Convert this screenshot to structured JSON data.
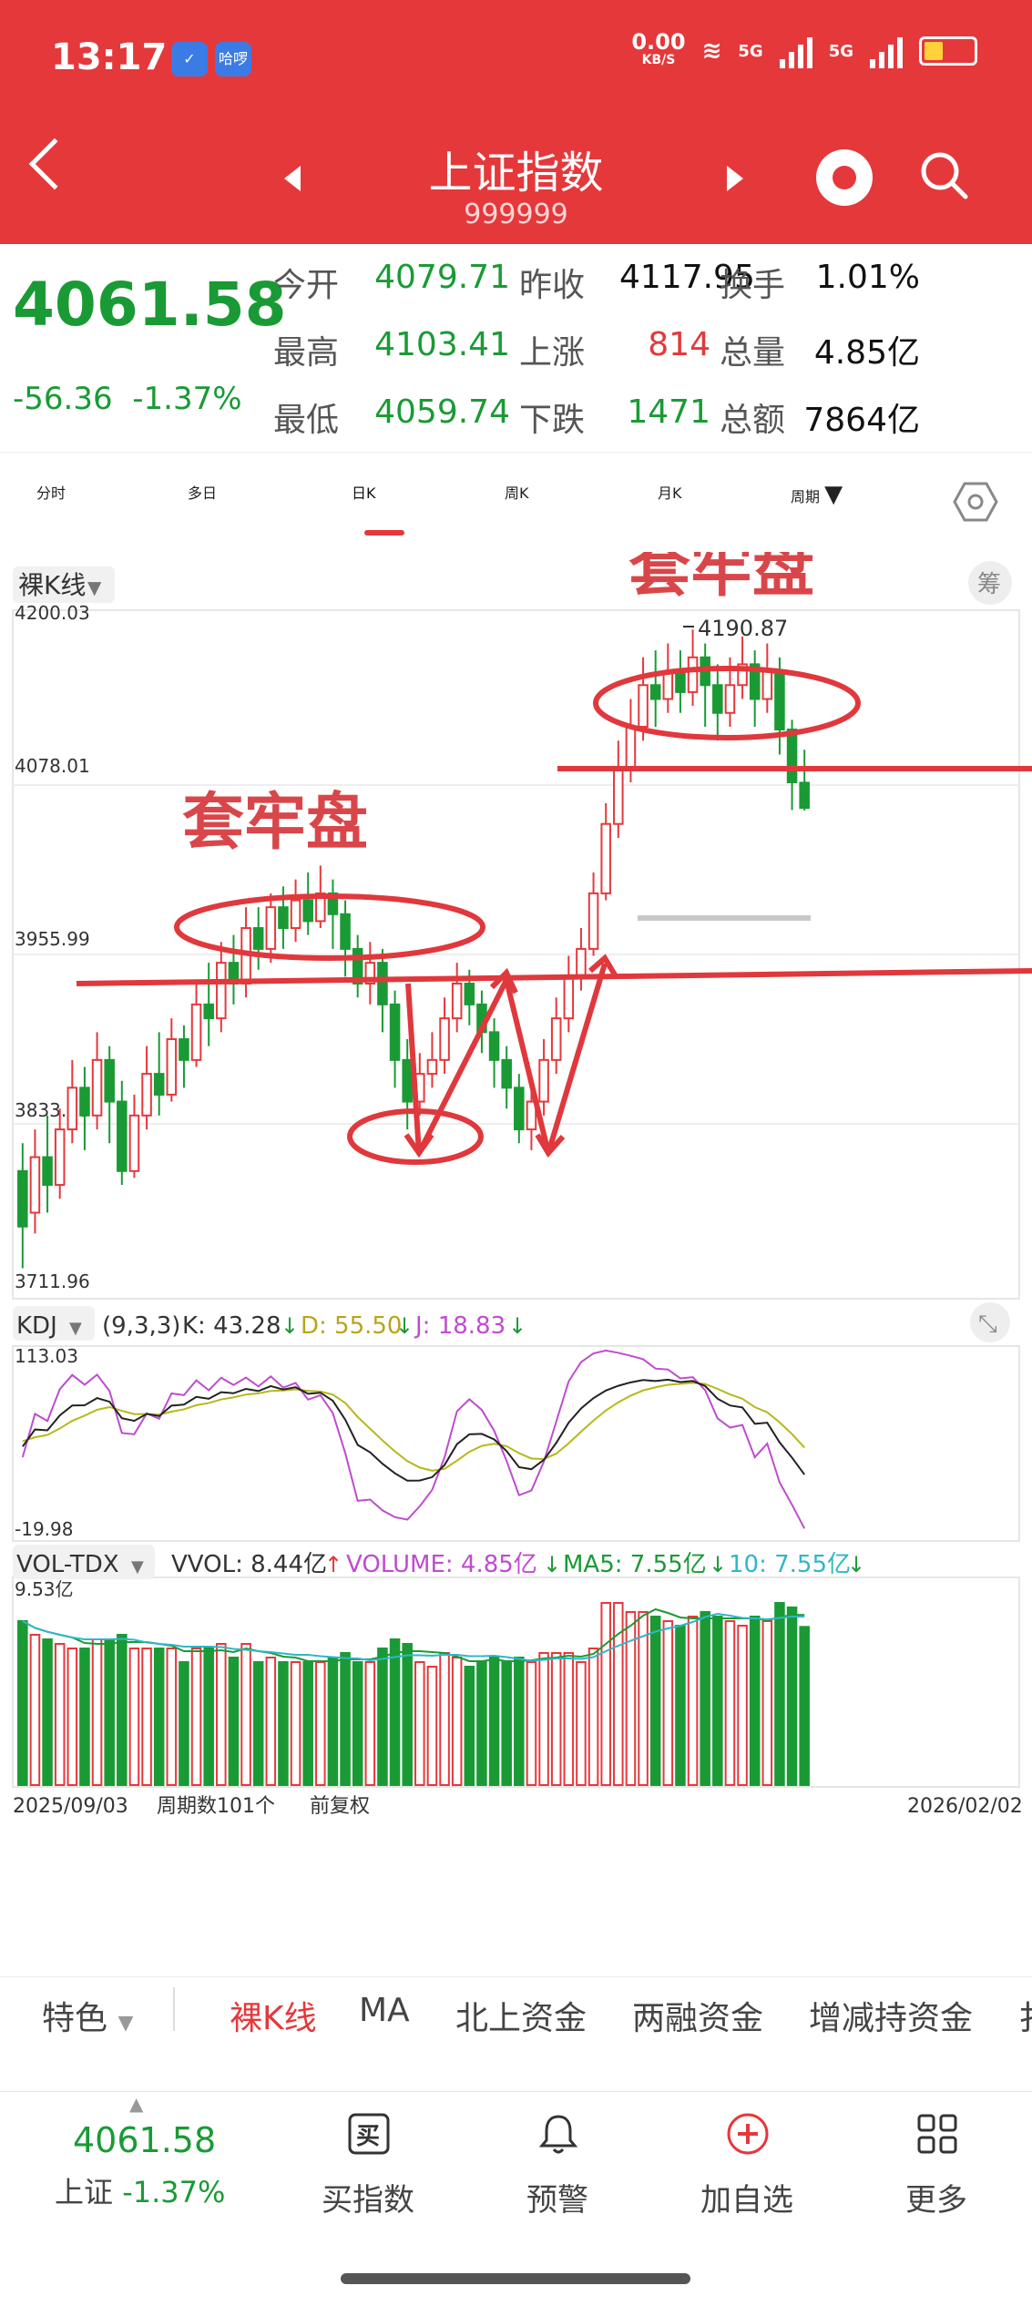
{
  "status_bar": {
    "time": "13:17",
    "app_icon_2": "哈啰",
    "net_speed": "0.00",
    "net_unit": "KB/S",
    "signal_1": "5G",
    "signal_2": "5G"
  },
  "header": {
    "title": "上证指数",
    "code": "999999"
  },
  "quote": {
    "price": "4061.58",
    "change": "-56.36",
    "change_pct": "-1.37%",
    "rows": [
      {
        "l1": "今开",
        "v1": "4079.71",
        "l2": "昨收",
        "v2": "4117.95",
        "l3": "换手",
        "v3": "1.01%"
      },
      {
        "l1": "最高",
        "v1": "4103.41",
        "l2": "上涨",
        "v2": "814",
        "l3": "总量",
        "v3": "4.85亿"
      },
      {
        "l1": "最低",
        "v1": "4059.74",
        "l2": "下跌",
        "v2": "1471",
        "l3": "总额",
        "v3": "7864亿"
      }
    ]
  },
  "tabs": [
    "分时",
    "多日",
    "日K",
    "周K",
    "月K",
    "周期"
  ],
  "active_tab": "日K",
  "chart_main": {
    "selector": "裸K线",
    "corner_button": "筹",
    "y_labels": [
      "4200.03",
      "4078.01",
      "3955.99",
      "3833.98",
      "3711.96"
    ],
    "high_marker": "4190.87",
    "annotation_top": "套牢盘",
    "annotation_mid": "套牢盘"
  },
  "kdj": {
    "selector": "KDJ",
    "params": "(9,3,3)",
    "k": "K: 43.28",
    "d": "D: 55.50",
    "j": "J: 18.83",
    "y_top": "113.03",
    "y_bottom": "-19.98"
  },
  "vol": {
    "selector": "VOL-TDX",
    "vvol": "VVOL: 8.44亿",
    "volume": "VOLUME: 4.85亿",
    "ma5": "MA5: 7.55亿",
    "ma10": "10: 7.55亿",
    "y_top": "9.53亿",
    "date_start": "2025/09/03",
    "period_count": "周期数101个",
    "adjust": "前复权",
    "date_end": "2026/02/02"
  },
  "toolbar": [
    "特色",
    "裸K线",
    "MA",
    "北上资金",
    "两融资金",
    "增减持资金",
    "扌"
  ],
  "footer": {
    "price": "4061.58",
    "name": "上证",
    "pct": "-1.37%",
    "buttons": [
      "买指数",
      "预警",
      "加自选",
      "更多"
    ],
    "buy_icon_char": "买"
  },
  "colors": {
    "brand_red": "#e5383b",
    "down_green": "#1a9a35",
    "up_red": "#e5383b",
    "k_line": "#222222",
    "d_line": "#b7b71a",
    "j_line": "#c04bd0",
    "ma10_line": "#2fb7c9"
  },
  "chart_data": {
    "type": "candlestick",
    "y_range": [
      3711.96,
      4200.03
    ],
    "candles": [
      [
        3800,
        3760,
        3820,
        3730
      ],
      [
        3770,
        3810,
        3830,
        3755
      ],
      [
        3810,
        3790,
        3840,
        3770
      ],
      [
        3790,
        3830,
        3845,
        3780
      ],
      [
        3830,
        3860,
        3880,
        3820
      ],
      [
        3860,
        3840,
        3875,
        3815
      ],
      [
        3840,
        3880,
        3900,
        3830
      ],
      [
        3880,
        3850,
        3890,
        3820
      ],
      [
        3850,
        3800,
        3865,
        3790
      ],
      [
        3800,
        3840,
        3855,
        3795
      ],
      [
        3840,
        3870,
        3890,
        3830
      ],
      [
        3870,
        3855,
        3900,
        3840
      ],
      [
        3855,
        3895,
        3910,
        3850
      ],
      [
        3895,
        3880,
        3905,
        3860
      ],
      [
        3880,
        3920,
        3935,
        3875
      ],
      [
        3920,
        3910,
        3950,
        3890
      ],
      [
        3910,
        3950,
        3965,
        3900
      ],
      [
        3950,
        3935,
        3970,
        3920
      ],
      [
        3935,
        3975,
        3990,
        3925
      ],
      [
        3975,
        3960,
        3990,
        3945
      ],
      [
        3960,
        3990,
        4000,
        3950
      ],
      [
        3990,
        3975,
        4005,
        3960
      ],
      [
        3975,
        3995,
        4010,
        3965
      ],
      [
        3995,
        3980,
        4015,
        3970
      ],
      [
        3980,
        4000,
        4020,
        3975
      ],
      [
        4000,
        3985,
        4010,
        3960
      ],
      [
        3985,
        3960,
        3995,
        3940
      ],
      [
        3960,
        3935,
        3970,
        3925
      ],
      [
        3935,
        3950,
        3965,
        3920
      ],
      [
        3950,
        3920,
        3960,
        3900
      ],
      [
        3920,
        3880,
        3930,
        3860
      ],
      [
        3880,
        3850,
        3895,
        3830
      ],
      [
        3850,
        3870,
        3885,
        3840
      ],
      [
        3870,
        3880,
        3900,
        3860
      ],
      [
        3880,
        3910,
        3925,
        3870
      ],
      [
        3910,
        3935,
        3950,
        3900
      ],
      [
        3935,
        3920,
        3945,
        3905
      ],
      [
        3920,
        3900,
        3930,
        3885
      ],
      [
        3900,
        3880,
        3910,
        3860
      ],
      [
        3880,
        3860,
        3890,
        3845
      ],
      [
        3860,
        3830,
        3870,
        3820
      ],
      [
        3830,
        3850,
        3860,
        3815
      ],
      [
        3850,
        3880,
        3895,
        3840
      ],
      [
        3880,
        3910,
        3925,
        3870
      ],
      [
        3910,
        3940,
        3955,
        3900
      ],
      [
        3940,
        3960,
        3975,
        3930
      ],
      [
        3960,
        4000,
        4015,
        3955
      ],
      [
        4000,
        4050,
        4065,
        3995
      ],
      [
        4050,
        4090,
        4110,
        4040
      ],
      [
        4090,
        4120,
        4140,
        4080
      ],
      [
        4120,
        4150,
        4170,
        4110
      ],
      [
        4150,
        4140,
        4175,
        4120
      ],
      [
        4140,
        4160,
        4180,
        4130
      ],
      [
        4160,
        4145,
        4175,
        4130
      ],
      [
        4145,
        4170,
        4190,
        4135
      ],
      [
        4170,
        4150,
        4180,
        4120
      ],
      [
        4150,
        4130,
        4165,
        4110
      ],
      [
        4130,
        4150,
        4170,
        4120
      ],
      [
        4150,
        4165,
        4185,
        4140
      ],
      [
        4165,
        4140,
        4175,
        4120
      ],
      [
        4140,
        4160,
        4180,
        4130
      ],
      [
        4160,
        4118,
        4170,
        4100
      ],
      [
        4118,
        4080,
        4125,
        4060
      ],
      [
        4079.71,
        4061.58,
        4103.41,
        4059.74
      ]
    ]
  }
}
